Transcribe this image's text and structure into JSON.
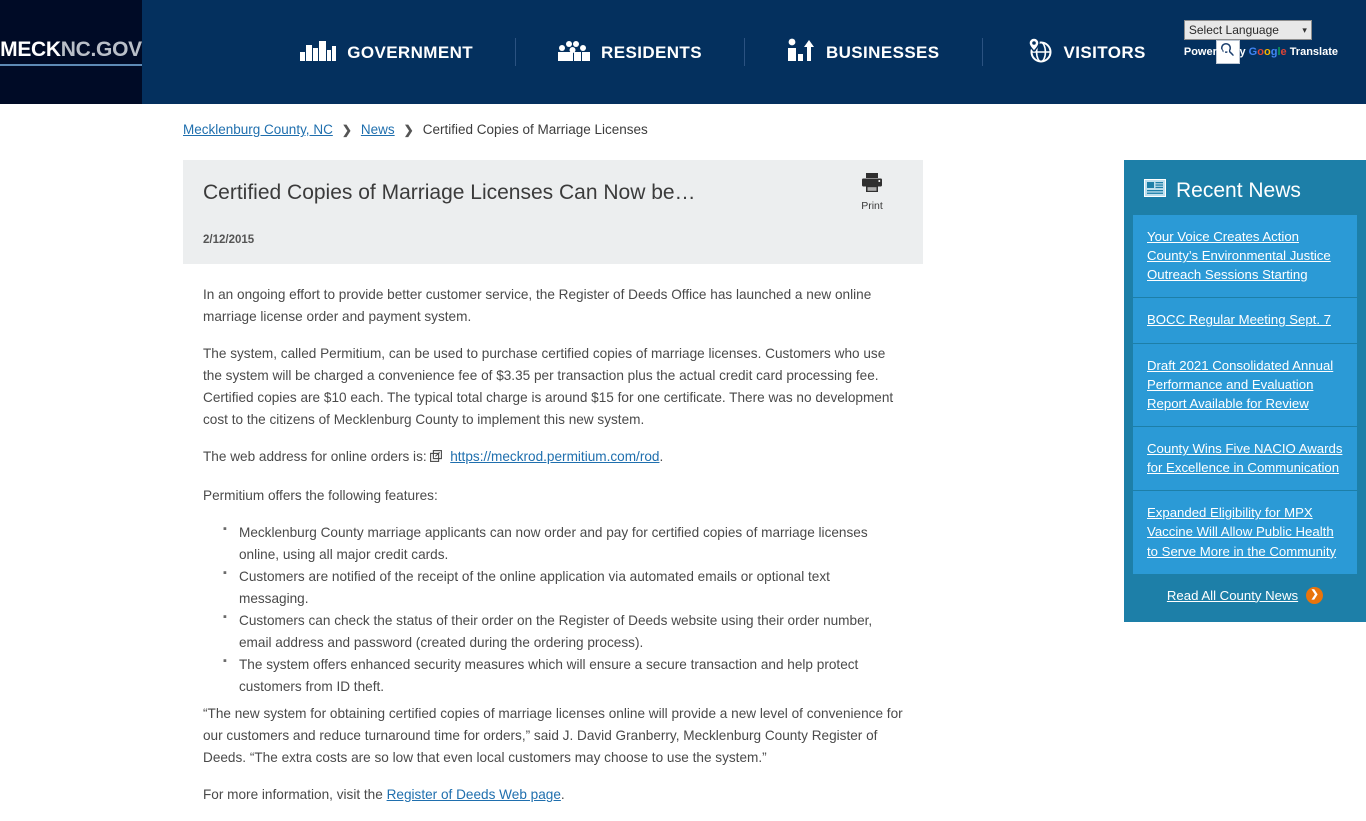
{
  "header": {
    "logo": {
      "primary": "MECK",
      "secondary": "NC.GOV"
    },
    "nav": [
      {
        "label": "GOVERNMENT",
        "icon": "buildings-icon"
      },
      {
        "label": "RESIDENTS",
        "icon": "people-group-icon"
      },
      {
        "label": "BUSINESSES",
        "icon": "business-person-arrow-icon"
      },
      {
        "label": "VISITORS",
        "icon": "globe-pin-icon"
      }
    ],
    "search_icon": "search-icon",
    "language": {
      "selected": "Select Language",
      "caret": "▾",
      "powered_prefix": "Powered by",
      "brand": "Google",
      "powered_suffix": "Translate"
    },
    "colors": {
      "nav_bg": "#04305e",
      "logo_bg": "#000b26"
    }
  },
  "breadcrumb": {
    "items": [
      {
        "label": "Mecklenburg County, NC",
        "link": true
      },
      {
        "label": "News",
        "link": true
      },
      {
        "label": "Certified Copies of Marriage Licenses",
        "link": false
      }
    ],
    "separator": "❯"
  },
  "article": {
    "title": "Certified Copies of Marriage Licenses Can Now be…",
    "date": "2/12/2015",
    "print_label": "Print",
    "print_icon": "printer-icon",
    "paragraph_1": "In an ongoing effort to provide better customer service, the Register of Deeds Office has launched a new online marriage license order and payment system.",
    "paragraph_2": "The system, called Permitium, can be used to purchase certified copies of marriage licenses. Customers who use the system will be charged a convenience fee of $3.35 per transaction plus the actual credit card processing fee. Certified copies are $10 each. The typical total charge is around $15 for one certificate. There was no development cost to the citizens of Mecklenburg County to implement this new system.",
    "web_address_prefix": "The web address for online orders is:",
    "web_address_link": "https://meckrod.permitium.com/rod",
    "web_address_suffix": ".",
    "features_intro": "Permitium offers the following features:",
    "features": [
      "Mecklenburg County marriage applicants can now order and pay for certified copies of marriage licenses online, using all major credit cards.",
      "Customers are notified of the receipt of the online application via automated emails or optional text messaging.",
      "Customers can check the status of their order on the Register of Deeds website using their order number, email address and password (created during the ordering process).",
      "The system offers enhanced security measures which will ensure a secure transaction and help protect customers from ID theft."
    ],
    "quote_paragraph": "“The new system for obtaining certified copies of marriage licenses online will provide a new level of convenience for our customers and reduce turnaround time for orders,” said J. David Granberry, Mecklenburg County Register of Deeds. “The extra costs are so low that even local customers may choose to use the system.”",
    "more_info_prefix": "For more information, visit the",
    "more_info_link": "Register of Deeds Web page",
    "more_info_suffix": "."
  },
  "sidebar": {
    "title": "Recent News",
    "icon": "newspaper-icon",
    "items": [
      {
        "label": "Your Voice Creates Action County’s Environmental Justice Outreach Sessions Starting"
      },
      {
        "label": "BOCC Regular Meeting Sept. 7"
      },
      {
        "label": "Draft 2021 Consolidated Annual Performance and Evaluation Report Available for Review"
      },
      {
        "label": "County Wins Five NACIO Awards for Excellence in Communication"
      },
      {
        "label": "Expanded Eligibility for MPX Vaccine Will Allow Public Health to Serve More in the Community"
      }
    ],
    "footer_link": "Read All County News",
    "footer_arrow": "❯",
    "colors": {
      "panel_bg": "#1d7fa8",
      "item_bg": "#2b9ad6",
      "arrow_bg": "#e8740c"
    }
  }
}
